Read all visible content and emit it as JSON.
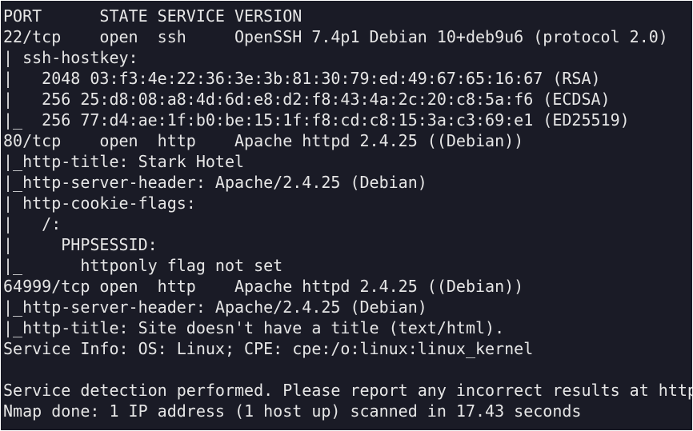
{
  "terminal": {
    "colors": {
      "background": "#1a1b26",
      "foreground": "#e6e6e6"
    },
    "lines": [
      "PORT      STATE SERVICE VERSION",
      "22/tcp    open  ssh     OpenSSH 7.4p1 Debian 10+deb9u6 (protocol 2.0)",
      "| ssh-hostkey:",
      "|   2048 03:f3:4e:22:36:3e:3b:81:30:79:ed:49:67:65:16:67 (RSA)",
      "|   256 25:d8:08:a8:4d:6d:e8:d2:f8:43:4a:2c:20:c8:5a:f6 (ECDSA)",
      "|_  256 77:d4:ae:1f:b0:be:15:1f:f8:cd:c8:15:3a:c3:69:e1 (ED25519)",
      "80/tcp    open  http    Apache httpd 2.4.25 ((Debian))",
      "|_http-title: Stark Hotel",
      "|_http-server-header: Apache/2.4.25 (Debian)",
      "| http-cookie-flags:",
      "|   /:",
      "|     PHPSESSID:",
      "|_      httponly flag not set",
      "64999/tcp open  http    Apache httpd 2.4.25 ((Debian))",
      "|_http-server-header: Apache/2.4.25 (Debian)",
      "|_http-title: Site doesn't have a title (text/html).",
      "Service Info: OS: Linux; CPE: cpe:/o:linux:linux_kernel",
      "",
      "Service detection performed. Please report any incorrect results at http",
      "Nmap done: 1 IP address (1 host up) scanned in 17.43 seconds"
    ]
  }
}
